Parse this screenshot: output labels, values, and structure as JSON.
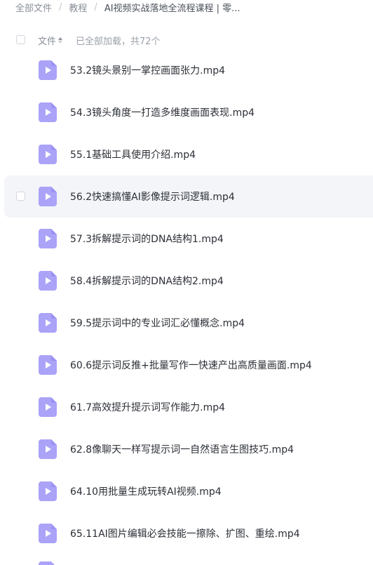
{
  "breadcrumb": {
    "items": [
      "全部文件",
      "教程"
    ],
    "current": "AI视频实战落地全流程课程 | 零...",
    "separator": "/"
  },
  "header": {
    "column_label": "文件",
    "status": "已全部加载，共72个"
  },
  "colors": {
    "icon_purple": "#8c84f2",
    "icon_purple_light": "#aaa3f7",
    "highlight_bg": "#f3f5f8"
  },
  "files": [
    {
      "name": "53.2镜头景别一掌控画面张力.mp4",
      "icon": "video-file-icon"
    },
    {
      "name": "54.3镜头角度一打造多维度画面表现.mp4",
      "icon": "video-file-icon"
    },
    {
      "name": "55.1基础工具使用介绍.mp4",
      "icon": "video-file-icon"
    },
    {
      "name": "56.2快速搞懂AI影像提示词逻辑.mp4",
      "icon": "video-file-icon",
      "hovered": true
    },
    {
      "name": "57.3拆解提示词的DNA结构1.mp4",
      "icon": "video-file-icon"
    },
    {
      "name": "58.4拆解提示词的DNA结构2.mp4",
      "icon": "video-file-icon"
    },
    {
      "name": "59.5提示词中的专业词汇必懂概念.mp4",
      "icon": "video-file-icon"
    },
    {
      "name": "60.6提示词反推+批量写作一快速产出高质量画面.mp4",
      "icon": "video-file-icon"
    },
    {
      "name": "61.7高效提升提示词写作能力.mp4",
      "icon": "video-file-icon"
    },
    {
      "name": "62.8像聊天一样写提示词一自然语言生图技巧.mp4",
      "icon": "video-file-icon"
    },
    {
      "name": "64.10用批量生成玩转AI视频.mp4",
      "icon": "video-file-icon"
    },
    {
      "name": "65.11AI图片编辑必会技能一擦除、扩图、重绘.mp4",
      "icon": "video-file-icon"
    }
  ]
}
